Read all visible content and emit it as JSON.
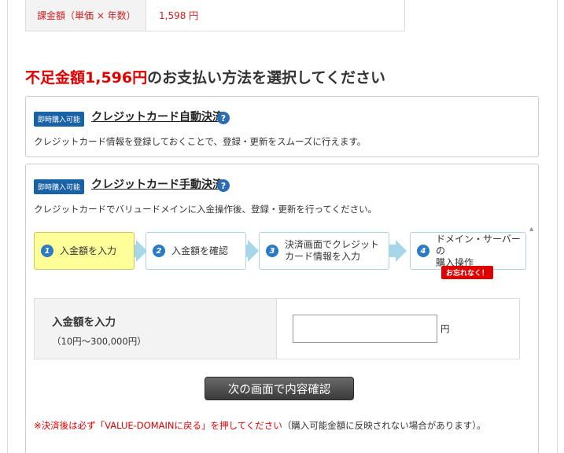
{
  "fee": {
    "label": "課金額（単価 × 年数）",
    "value": "1,598 円"
  },
  "heading": {
    "shortfall": "不足金額1,596円",
    "rest": "のお支払い方法を選択してください"
  },
  "auto_option": {
    "badge": "即時購入可能",
    "title": "クレジットカード自動決済",
    "help": "?",
    "description": "クレジットカード情報を登録しておくことで、登録・更新をスムーズに行えます。"
  },
  "manual_option": {
    "badge": "即時購入可能",
    "title": "クレジットカード手動決済",
    "help": "?",
    "description": "クレジットカードでバリュードメインに入金操作後、登録・更新を行ってください。"
  },
  "steps": [
    {
      "num": "1",
      "line1": "入金額を入力",
      "line2": ""
    },
    {
      "num": "2",
      "line1": "入金額を確認",
      "line2": ""
    },
    {
      "num": "3",
      "line1": "決済画面でクレジット",
      "line2": "カード情報を入力"
    },
    {
      "num": "4",
      "line1": "ドメイン・サーバーの",
      "line2": "購入操作"
    }
  ],
  "reminder": "お忘れなく！",
  "input": {
    "label": "入金額を入力",
    "range": "（10円〜300,000円）",
    "value": "",
    "placeholder": "",
    "unit": "円"
  },
  "confirm_button": "次の画面で内容確認",
  "notice": {
    "red": "※決済後は必ず「VALUE-DOMAINに戻る」を押してください",
    "gray": "（購入可能金額に反映されない場合があります）。"
  },
  "colors": {
    "accent_red": "#e00000",
    "badge_blue": "#1a62a6",
    "step_active": "#ffff99",
    "arrow": "#a5d6ea"
  }
}
